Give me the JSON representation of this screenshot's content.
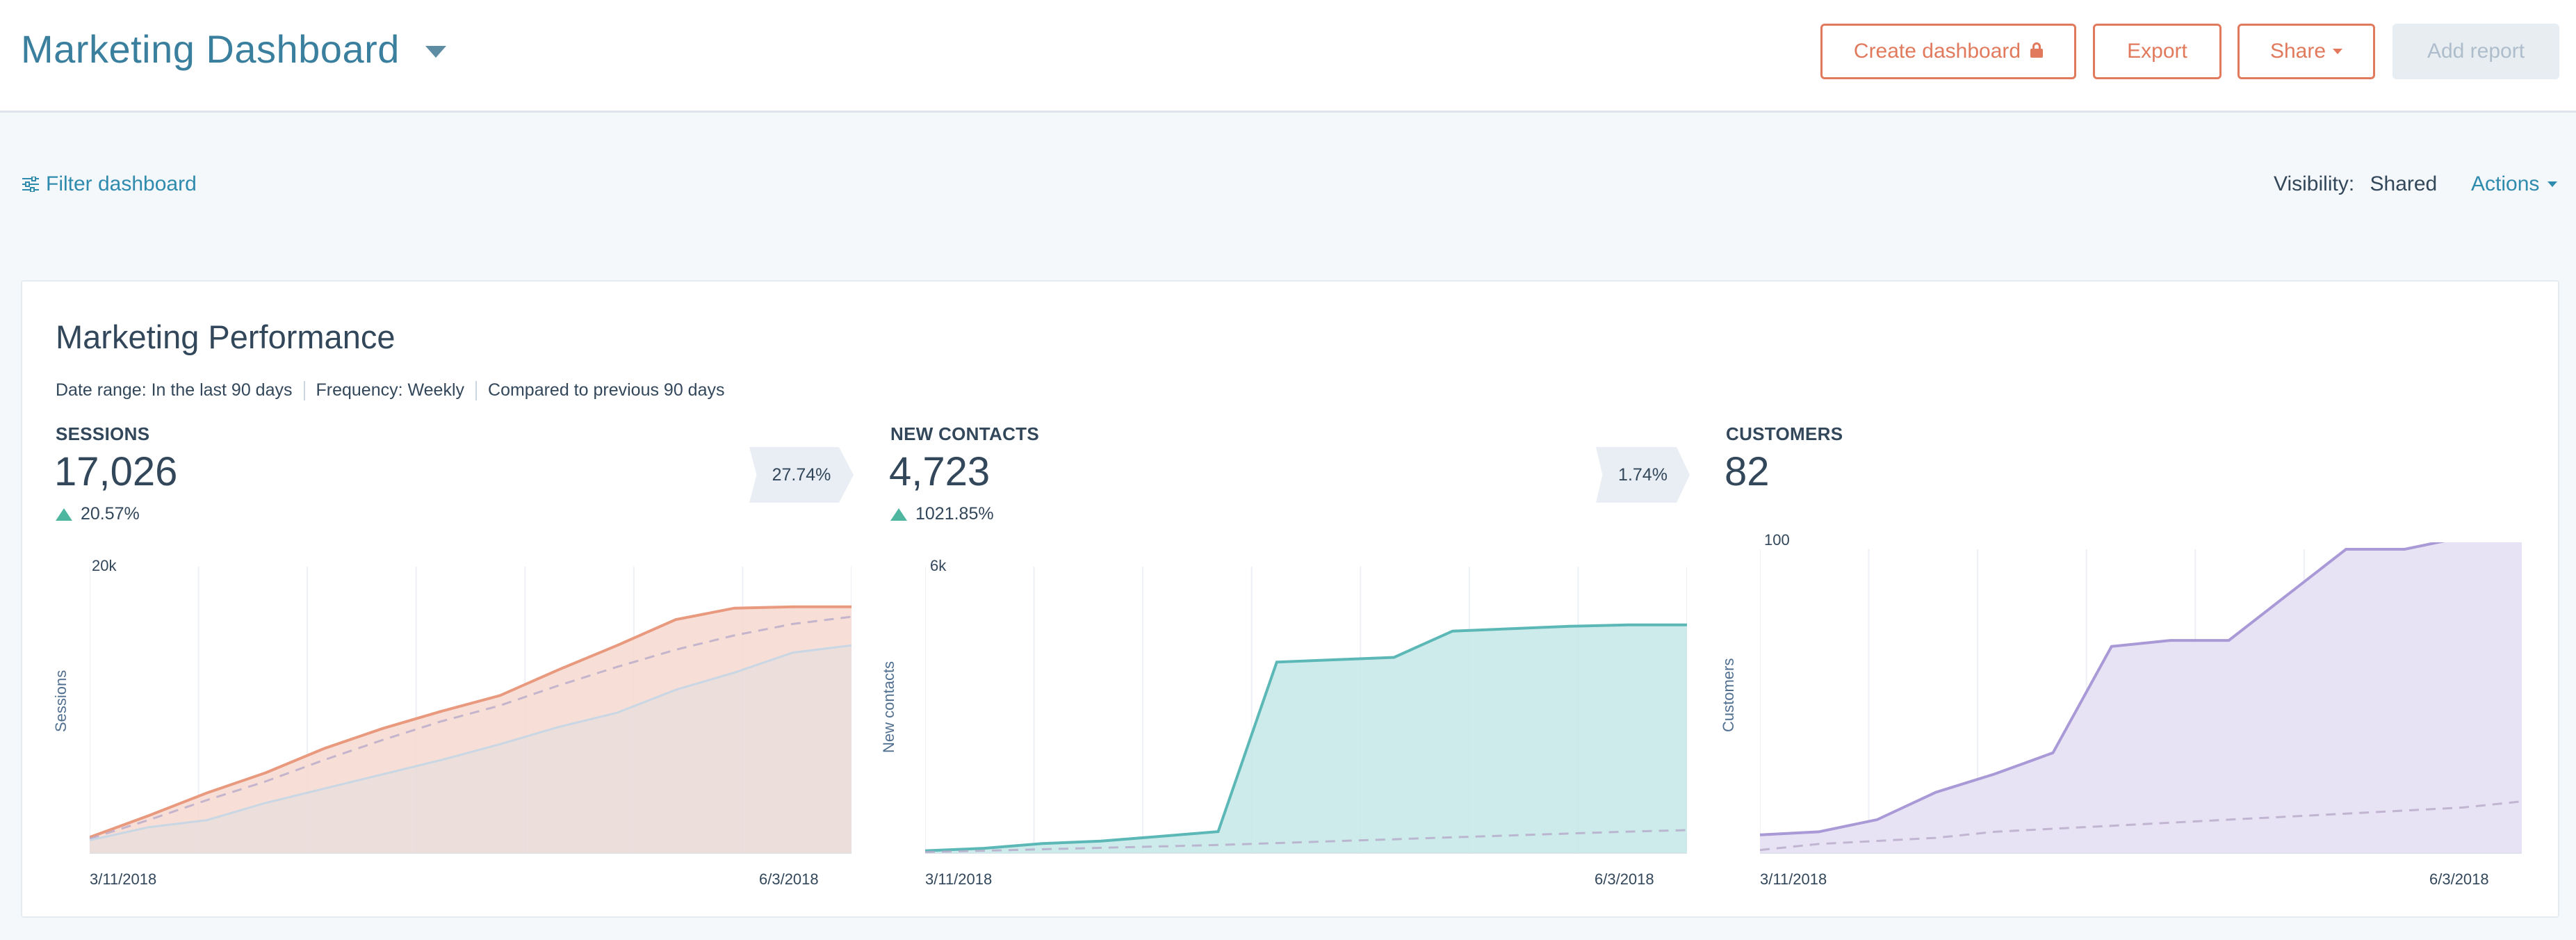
{
  "header": {
    "title": "Marketing Dashboard",
    "buttons": {
      "create_dashboard": "Create dashboard",
      "export": "Export",
      "share": "Share",
      "add_report": "Add report"
    }
  },
  "toolbar": {
    "filter_label": "Filter dashboard",
    "visibility_label": "Visibility:",
    "visibility_value": "Shared",
    "actions_label": "Actions"
  },
  "card": {
    "title": "Marketing Performance",
    "meta": {
      "date_range": "Date range: In the last 90 days",
      "frequency": "Frequency: Weekly",
      "compared": "Compared to previous 90 days"
    },
    "metrics": [
      {
        "label": "SESSIONS",
        "value": "17,026",
        "change": "20.57%",
        "compare_tag": "27.74%",
        "chart": {
          "y_axis_label": "Sessions",
          "y_max_label": "20k",
          "x_start_label": "3/11/2018",
          "x_end_label": "6/3/2018",
          "color": "#e8997e",
          "fill": "#f6d9d0"
        }
      },
      {
        "label": "NEW CONTACTS",
        "value": "4,723",
        "change": "1021.85%",
        "compare_tag": "1.74%",
        "chart": {
          "y_axis_label": "New contacts",
          "y_max_label": "6k",
          "x_start_label": "3/11/2018",
          "x_end_label": "6/3/2018",
          "color": "#5cb8b6",
          "fill": "#c6e8e8"
        }
      },
      {
        "label": "CUSTOMERS",
        "value": "82",
        "chart": {
          "y_axis_label": "Customers",
          "y_max_label": "100",
          "x_start_label": "3/11/2018",
          "x_end_label": "6/3/2018",
          "color": "#a999d6",
          "fill": "#e4def2"
        }
      }
    ]
  },
  "chart_data": [
    {
      "type": "area",
      "ylabel": "Sessions",
      "ylim": [
        0,
        20000
      ],
      "x_tick_labels": [
        "3/11/2018",
        "6/3/2018"
      ],
      "points_count": 14,
      "series": [
        {
          "name": "current",
          "style": "solid",
          "values": [
            1100,
            2600,
            4200,
            5600,
            7300,
            8700,
            9900,
            11000,
            12800,
            14500,
            16300,
            17100,
            17200,
            17200
          ]
        },
        {
          "name": "previous",
          "style": "dashed",
          "values": [
            1000,
            2300,
            3700,
            5000,
            6500,
            7900,
            9200,
            10300,
            11700,
            13000,
            14200,
            15200,
            16000,
            16500
          ]
        },
        {
          "name": "baseline",
          "style": "light",
          "values": [
            900,
            1800,
            2300,
            3500,
            4500,
            5500,
            6500,
            7600,
            8800,
            9800,
            11400,
            12600,
            14000,
            14500
          ]
        }
      ]
    },
    {
      "type": "area",
      "ylabel": "New contacts",
      "ylim": [
        0,
        6000
      ],
      "x_tick_labels": [
        "3/11/2018",
        "6/3/2018"
      ],
      "points_count": 14,
      "series": [
        {
          "name": "current",
          "style": "solid",
          "values": [
            50,
            100,
            200,
            250,
            350,
            450,
            4000,
            4050,
            4100,
            4650,
            4700,
            4750,
            4780,
            4780
          ]
        },
        {
          "name": "previous",
          "style": "dashed",
          "values": [
            20,
            50,
            80,
            110,
            140,
            170,
            210,
            250,
            290,
            330,
            370,
            410,
            450,
            480
          ]
        }
      ]
    },
    {
      "type": "area",
      "ylabel": "Customers",
      "ylim": [
        0,
        100
      ],
      "x_tick_labels": [
        "3/11/2018",
        "6/3/2018"
      ],
      "points_count": 14,
      "series": [
        {
          "name": "current",
          "style": "solid",
          "values": [
            6,
            7,
            11,
            20,
            26,
            33,
            68,
            70,
            70,
            85,
            100,
            100,
            104,
            104
          ]
        },
        {
          "name": "previous",
          "style": "dashed",
          "values": [
            1,
            3,
            4,
            5,
            7,
            8,
            9,
            10,
            11,
            12,
            13,
            14,
            15,
            17
          ]
        }
      ]
    }
  ]
}
